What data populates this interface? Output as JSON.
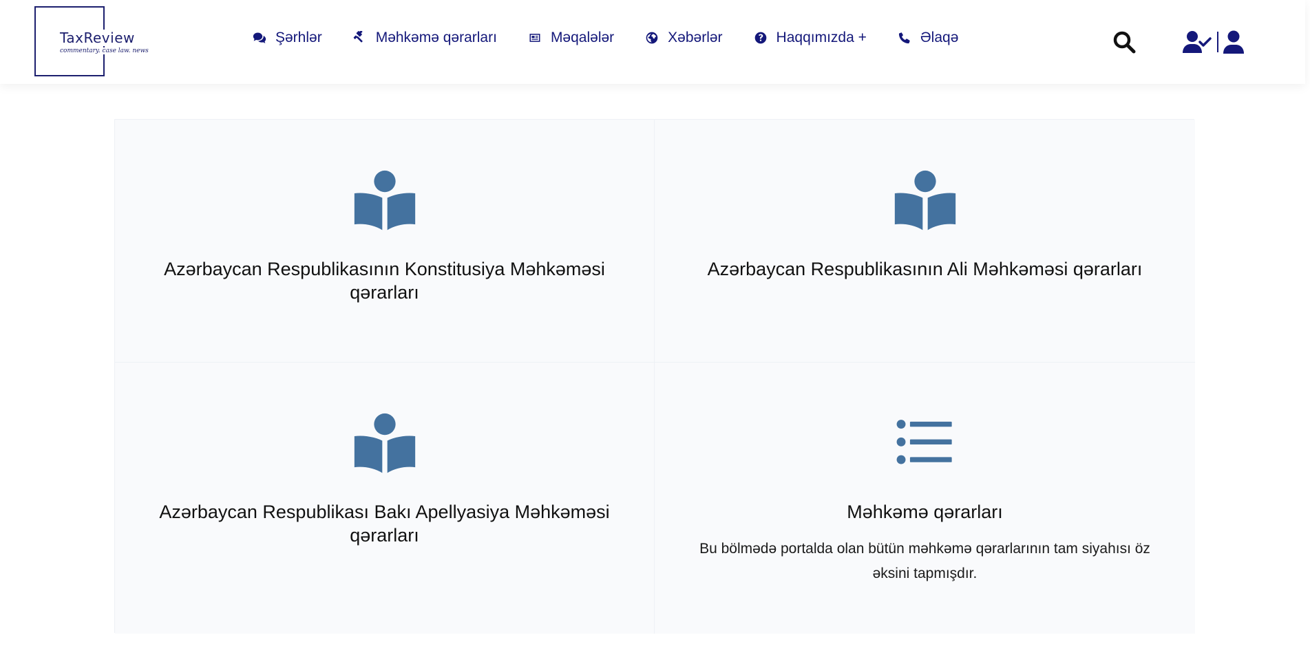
{
  "brand": {
    "name": "TaxReview",
    "tagline": "commentary. case law. news"
  },
  "nav": {
    "items": [
      {
        "label": "Şərhlər",
        "icon": "comments-icon"
      },
      {
        "label": "Məhkəmə qərarları",
        "icon": "gavel-icon"
      },
      {
        "label": "Məqalələr",
        "icon": "newspaper-icon"
      },
      {
        "label": "Xəbərlər",
        "icon": "globe-icon"
      },
      {
        "label": "Haqqımızda +",
        "icon": "question-circle-icon"
      },
      {
        "label": "Əlaqə",
        "icon": "phone-icon"
      }
    ]
  },
  "header_actions": {
    "search_icon": "search-icon",
    "user_check_icon": "user-check-icon",
    "user_icon": "user-icon"
  },
  "colors": {
    "brand": "#1c1f6e",
    "nav_text": "#14187a",
    "card_icon": "#44729f",
    "card_bg": "#f9fafc",
    "card_border": "#eef1f5"
  },
  "cards": [
    {
      "title": "Azərbaycan Respublikasının Konstitusiya Məhkəməsi qərarları",
      "icon": "book-reader-icon",
      "description": ""
    },
    {
      "title": "Azərbaycan Respublikasının Ali Məhkəməsi qərarları",
      "icon": "book-reader-icon",
      "description": ""
    },
    {
      "title": "Azərbaycan Respublikası Bakı Apellyasiya Məhkəməsi qərarları",
      "icon": "book-reader-icon",
      "description": ""
    },
    {
      "title": "Məhkəmə qərarları",
      "icon": "list-icon",
      "description": "Bu bölmədə portalda olan bütün məhkəmə qərarlarının tam siyahısı öz əksini tapmışdır."
    }
  ]
}
